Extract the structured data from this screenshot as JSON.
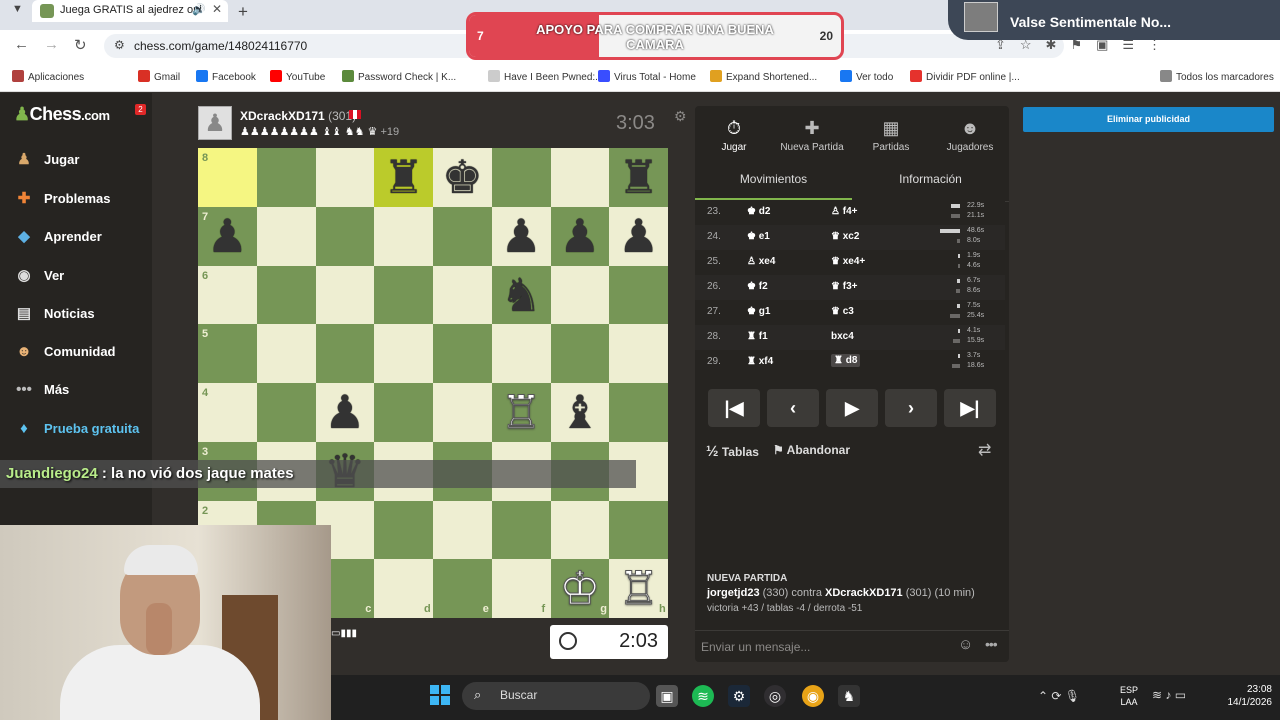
{
  "browser": {
    "tab_title": "Juega GRATIS al ajedrez onl",
    "url": "chess.com/game/148024116770",
    "bookmarks": [
      {
        "label": "Aplicaciones",
        "color": "#b0413e"
      },
      {
        "label": "Gmail",
        "color": "#d93025"
      },
      {
        "label": "Facebook",
        "color": "#1877f2"
      },
      {
        "label": "YouTube",
        "color": "#ff0000"
      },
      {
        "label": "Password Check | K...",
        "color": "#5b8a3c"
      },
      {
        "label": "Have I Been Pwned:...",
        "color": "#cccccc"
      },
      {
        "label": "Virus Total - Home",
        "color": "#394eff"
      },
      {
        "label": "Expand Shortened...",
        "color": "#e0a020"
      },
      {
        "label": "Ver todo",
        "color": "#1877f2"
      },
      {
        "label": "Dividir PDF online |...",
        "color": "#e5322d"
      },
      {
        "label": "Todos los marcadores",
        "color": "#888888"
      }
    ]
  },
  "overlay": {
    "donation": {
      "current": "7",
      "goal": "20",
      "text": "APOYO PARA COMPRAR UNA BUENA CAMARA",
      "progress_fraction": 0.35
    },
    "music_title": "Valse Sentimentale No...",
    "chat_user": "Juandiego24",
    "chat_message": " : la no vió dos jaque mates"
  },
  "sidebar": {
    "brand": "Chess",
    "brand_suffix": ".com",
    "notifications": "2",
    "items": [
      {
        "label": "Jugar",
        "icon": "pawn-icon",
        "glyph": "♟"
      },
      {
        "label": "Problemas",
        "icon": "puzzle-icon",
        "glyph": "✚"
      },
      {
        "label": "Aprender",
        "icon": "learn-icon",
        "glyph": "◆"
      },
      {
        "label": "Ver",
        "icon": "binoculars-icon",
        "glyph": "◉"
      },
      {
        "label": "Noticias",
        "icon": "news-icon",
        "glyph": "▤"
      },
      {
        "label": "Comunidad",
        "icon": "community-icon",
        "glyph": "☻"
      },
      {
        "label": "Más",
        "icon": "more-icon",
        "glyph": "•••"
      },
      {
        "label": "Prueba gratuita",
        "icon": "diamond-icon",
        "glyph": "♦"
      }
    ]
  },
  "game": {
    "top_player": {
      "name": "XDcrackXD171",
      "rating": "(301)",
      "captured": "♟♟♟♟♟♟♟♟ ♝♝ ♞♞ ♛",
      "advantage": "+19",
      "clock": "3:03"
    },
    "bottom_player": {
      "clock": "2:03"
    },
    "ranks": [
      "8",
      "7",
      "6",
      "5",
      "4",
      "3",
      "2"
    ],
    "files": [
      "c",
      "d",
      "e",
      "f",
      "g",
      "h"
    ],
    "pieces": [
      {
        "sq": "d8",
        "p": "♜",
        "c": "b"
      },
      {
        "sq": "e8",
        "p": "♚",
        "c": "b"
      },
      {
        "sq": "h8",
        "p": "♜",
        "c": "b"
      },
      {
        "sq": "a7",
        "p": "♟",
        "c": "b"
      },
      {
        "sq": "f7",
        "p": "♟",
        "c": "b"
      },
      {
        "sq": "g7",
        "p": "♟",
        "c": "b"
      },
      {
        "sq": "h7",
        "p": "♟",
        "c": "b"
      },
      {
        "sq": "f6",
        "p": "♞",
        "c": "b"
      },
      {
        "sq": "c4",
        "p": "♟",
        "c": "b"
      },
      {
        "sq": "f4",
        "p": "♖",
        "c": "w"
      },
      {
        "sq": "g4",
        "p": "♝",
        "c": "b"
      },
      {
        "sq": "c3",
        "p": "♛",
        "c": "b"
      },
      {
        "sq": "g1",
        "p": "♔",
        "c": "w"
      },
      {
        "sq": "h1",
        "p": "♖",
        "c": "w"
      }
    ],
    "highlights": [
      "a8",
      "d8"
    ]
  },
  "panel": {
    "tabs": [
      {
        "label": "Jugar",
        "glyph": "⏱",
        "icon": "stopwatch-icon"
      },
      {
        "label": "Nueva Partida",
        "glyph": "✚",
        "icon": "plus-icon"
      },
      {
        "label": "Partidas",
        "glyph": "▦",
        "icon": "board-icon"
      },
      {
        "label": "Jugadores",
        "glyph": "☻",
        "icon": "players-icon"
      }
    ],
    "subtabs": [
      "Movimientos",
      "Información"
    ],
    "moves": [
      {
        "n": "23.",
        "w": "♚ d2",
        "b": "♙ f4+",
        "wt": "22.9s",
        "bt": "21.1s",
        "wf": 0.47,
        "bf": 0.43
      },
      {
        "n": "24.",
        "w": "♚ e1",
        "b": "♛ xc2",
        "wt": "48.6s",
        "bt": "8.0s",
        "wf": 1.0,
        "bf": 0.16
      },
      {
        "n": "25.",
        "w": "♙ xe4",
        "b": "♛ xe4+",
        "wt": "1.9s",
        "bt": "4.6s",
        "wf": 0.04,
        "bf": 0.09
      },
      {
        "n": "26.",
        "w": "♚ f2",
        "b": "♛ f3+",
        "wt": "6.7s",
        "bt": "8.6s",
        "wf": 0.14,
        "bf": 0.18
      },
      {
        "n": "27.",
        "w": "♚ g1",
        "b": "♛ c3",
        "wt": "7.5s",
        "bt": "25.4s",
        "wf": 0.15,
        "bf": 0.52
      },
      {
        "n": "28.",
        "w": "♜ f1",
        "b": "bxc4",
        "wt": "4.1s",
        "bt": "15.9s",
        "wf": 0.08,
        "bf": 0.33
      },
      {
        "n": "29.",
        "w": "♜ xf4",
        "b": "♜ d8",
        "wt": "3.7s",
        "bt": "18.6s",
        "wf": 0.08,
        "bf": 0.38
      }
    ],
    "draw_label": "Tablas",
    "draw_prefix": "½",
    "resign_label": "Abandonar",
    "new_game_label": "NUEVA PARTIDA",
    "game_players": "jorgetjd23",
    "game_players_rating": " (330) contra ",
    "game_opponent": "XDcrackXD171",
    "game_opponent_rating": " (301) (10 min)",
    "game_stats": "victoria +43 / tablas -4 / derrota -51",
    "message_placeholder": "Enviar un mensaje...",
    "ad_label": "Eliminar publicidad"
  },
  "taskbar": {
    "search_label": "Buscar",
    "lang_top": "ESP",
    "lang_bottom": "LAA",
    "time": "23:08",
    "date": "14/1/2026"
  }
}
